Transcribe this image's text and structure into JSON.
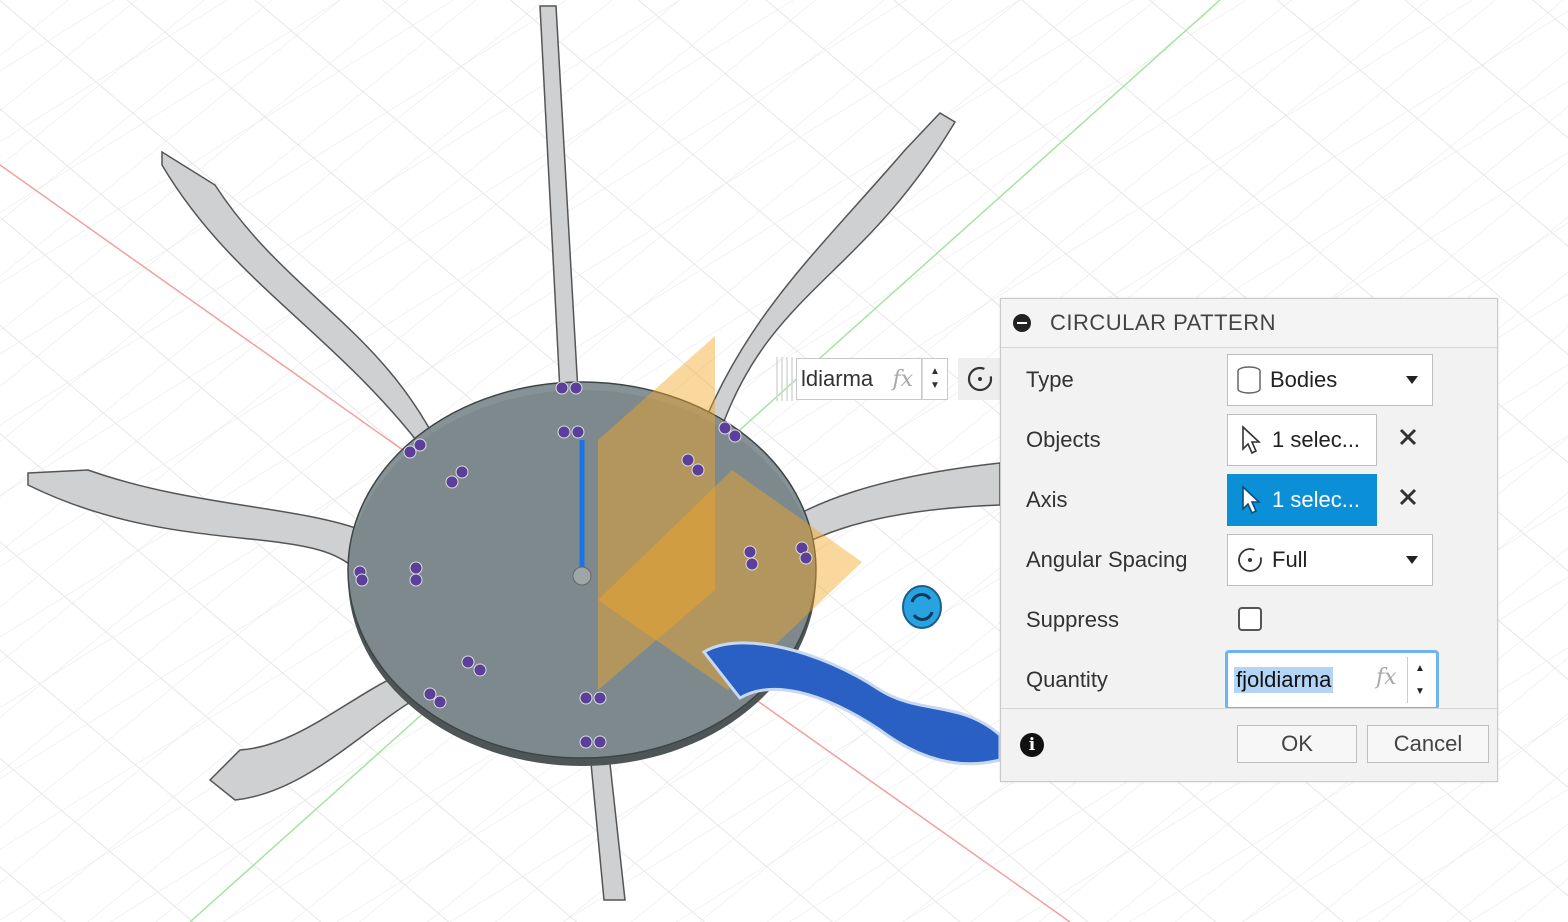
{
  "viewport": {
    "float_input": {
      "value": "ldiarma",
      "fx_label": "fx"
    }
  },
  "dialog": {
    "title": "CIRCULAR PATTERN",
    "rows": {
      "type": {
        "label": "Type",
        "value": "Bodies"
      },
      "objects": {
        "label": "Objects",
        "value": "1 selec..."
      },
      "axis": {
        "label": "Axis",
        "value": "1 selec..."
      },
      "angular_spacing": {
        "label": "Angular Spacing",
        "value": "Full"
      },
      "suppress": {
        "label": "Suppress",
        "checked": false
      },
      "quantity": {
        "label": "Quantity",
        "value": "fjoldiarma",
        "fx_label": "fx"
      }
    },
    "footer": {
      "ok_label": "OK",
      "cancel_label": "Cancel"
    }
  },
  "colors": {
    "accent_blue": "#0b8fd6",
    "selected_body": "#2a60c4",
    "plane_orange": "#f5a623",
    "disk": "#7f8c8f"
  }
}
